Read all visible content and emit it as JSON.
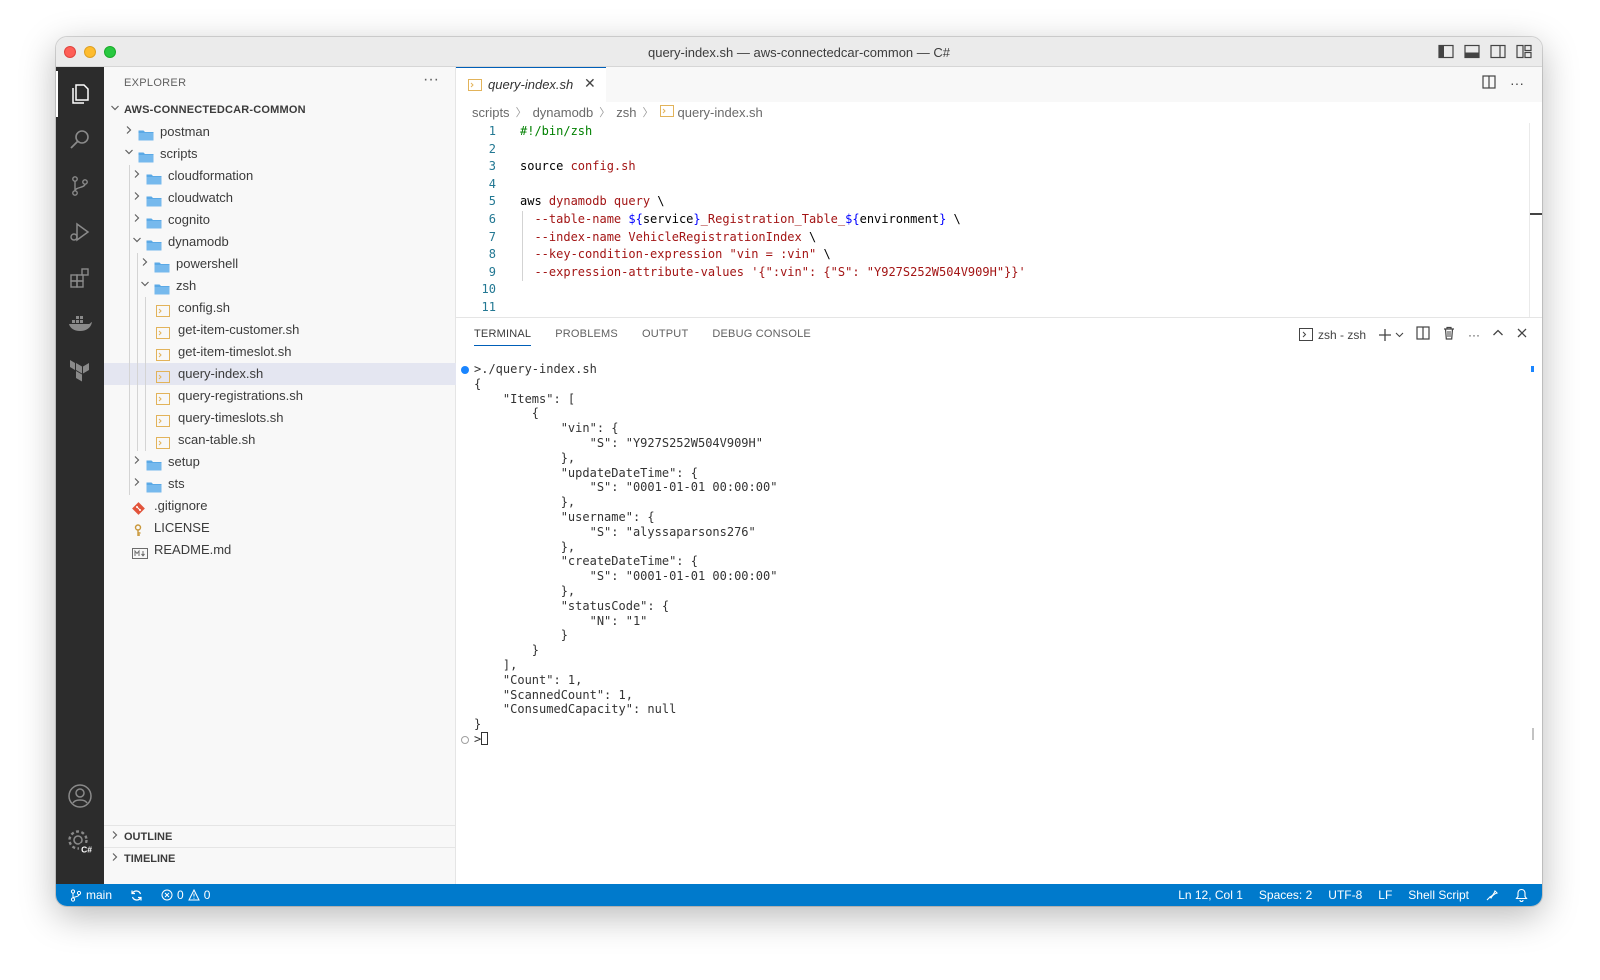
{
  "window": {
    "title": "query-index.sh — aws-connectedcar-common — C#"
  },
  "activity": {
    "badge": "C#"
  },
  "sidebar": {
    "header": "EXPLORER",
    "more": "···",
    "root": "AWS-CONNECTEDCAR-COMMON",
    "tree": [
      {
        "label": "postman",
        "type": "folder",
        "depth": 0,
        "state": "closed"
      },
      {
        "label": "scripts",
        "type": "folder",
        "depth": 0,
        "state": "open"
      },
      {
        "label": "cloudformation",
        "type": "folder",
        "depth": 1,
        "state": "closed"
      },
      {
        "label": "cloudwatch",
        "type": "folder",
        "depth": 1,
        "state": "closed"
      },
      {
        "label": "cognito",
        "type": "folder",
        "depth": 1,
        "state": "closed"
      },
      {
        "label": "dynamodb",
        "type": "folder",
        "depth": 1,
        "state": "open"
      },
      {
        "label": "powershell",
        "type": "folder",
        "depth": 2,
        "state": "closed"
      },
      {
        "label": "zsh",
        "type": "folder",
        "depth": 2,
        "state": "open"
      },
      {
        "label": "config.sh",
        "type": "shell",
        "depth": 3
      },
      {
        "label": "get-item-customer.sh",
        "type": "shell",
        "depth": 3
      },
      {
        "label": "get-item-timeslot.sh",
        "type": "shell",
        "depth": 3
      },
      {
        "label": "query-index.sh",
        "type": "shell",
        "depth": 3,
        "selected": true
      },
      {
        "label": "query-registrations.sh",
        "type": "shell",
        "depth": 3
      },
      {
        "label": "query-timeslots.sh",
        "type": "shell",
        "depth": 3
      },
      {
        "label": "scan-table.sh",
        "type": "shell",
        "depth": 3
      },
      {
        "label": "setup",
        "type": "folder",
        "depth": 1,
        "state": "closed"
      },
      {
        "label": "sts",
        "type": "folder",
        "depth": 1,
        "state": "closed"
      },
      {
        "label": ".gitignore",
        "type": "git",
        "depth": 0
      },
      {
        "label": "LICENSE",
        "type": "license",
        "depth": 0
      },
      {
        "label": "README.md",
        "type": "md",
        "depth": 0
      }
    ],
    "outline": "OUTLINE",
    "timeline": "TIMELINE"
  },
  "editor": {
    "tab_label": "query-index.sh",
    "breadcrumb": [
      "scripts",
      "dynamodb",
      "zsh",
      "query-index.sh"
    ],
    "lines": [
      {
        "n": "1",
        "tokens": [
          [
            "c",
            "#!/bin/zsh"
          ]
        ]
      },
      {
        "n": "2",
        "tokens": []
      },
      {
        "n": "3",
        "tokens": [
          [
            "p",
            "source "
          ],
          [
            "s",
            "config.sh"
          ]
        ]
      },
      {
        "n": "4",
        "tokens": []
      },
      {
        "n": "5",
        "tokens": [
          [
            "p",
            "aws "
          ],
          [
            "s",
            "dynamodb query "
          ],
          [
            "p",
            "\\"
          ]
        ]
      },
      {
        "n": "6",
        "tokens": [
          [
            "s",
            "  --table-name "
          ],
          [
            "v",
            "${"
          ],
          [
            "p",
            "service"
          ],
          [
            "v",
            "}"
          ],
          [
            "s",
            "_Registration_Table_"
          ],
          [
            "v",
            "${"
          ],
          [
            "p",
            "environment"
          ],
          [
            "v",
            "}"
          ],
          [
            "p",
            " \\"
          ]
        ]
      },
      {
        "n": "7",
        "tokens": [
          [
            "s",
            "  --index-name VehicleRegistrationIndex "
          ],
          [
            "p",
            "\\"
          ]
        ]
      },
      {
        "n": "8",
        "tokens": [
          [
            "s",
            "  --key-condition-expression \"vin = :vin\" "
          ],
          [
            "p",
            "\\"
          ]
        ]
      },
      {
        "n": "9",
        "tokens": [
          [
            "s",
            "  --expression-attribute-values '{\":vin\": {\"S\": \"Y927S252W504V909H\"}}'"
          ]
        ]
      },
      {
        "n": "10",
        "tokens": []
      },
      {
        "n": "11",
        "tokens": []
      }
    ]
  },
  "panel": {
    "tabs": [
      "TERMINAL",
      "PROBLEMS",
      "OUTPUT",
      "DEBUG CONSOLE"
    ],
    "terminal_name": "zsh - zsh",
    "lines": [
      ">./query-index.sh",
      "{",
      "    \"Items\": [",
      "        {",
      "            \"vin\": {",
      "                \"S\": \"Y927S252W504V909H\"",
      "            },",
      "            \"updateDateTime\": {",
      "                \"S\": \"0001-01-01 00:00:00\"",
      "            },",
      "            \"username\": {",
      "                \"S\": \"alyssaparsons276\"",
      "            },",
      "            \"createDateTime\": {",
      "                \"S\": \"0001-01-01 00:00:00\"",
      "            },",
      "            \"statusCode\": {",
      "                \"N\": \"1\"",
      "            }",
      "        }",
      "    ],",
      "    \"Count\": 1,",
      "    \"ScannedCount\": 1,",
      "    \"ConsumedCapacity\": null",
      "}"
    ],
    "prompt": ">"
  },
  "statusbar": {
    "branch": "main",
    "errors": "0",
    "warnings": "0",
    "position": "Ln 12, Col 1",
    "spaces": "Spaces: 2",
    "encoding": "UTF-8",
    "eol": "LF",
    "language": "Shell Script"
  },
  "colors": {
    "accent": "#007acc",
    "activity_bg": "#2c2c2c",
    "folder": "#5aa9e6",
    "shell_icon": "#e8c16b"
  }
}
